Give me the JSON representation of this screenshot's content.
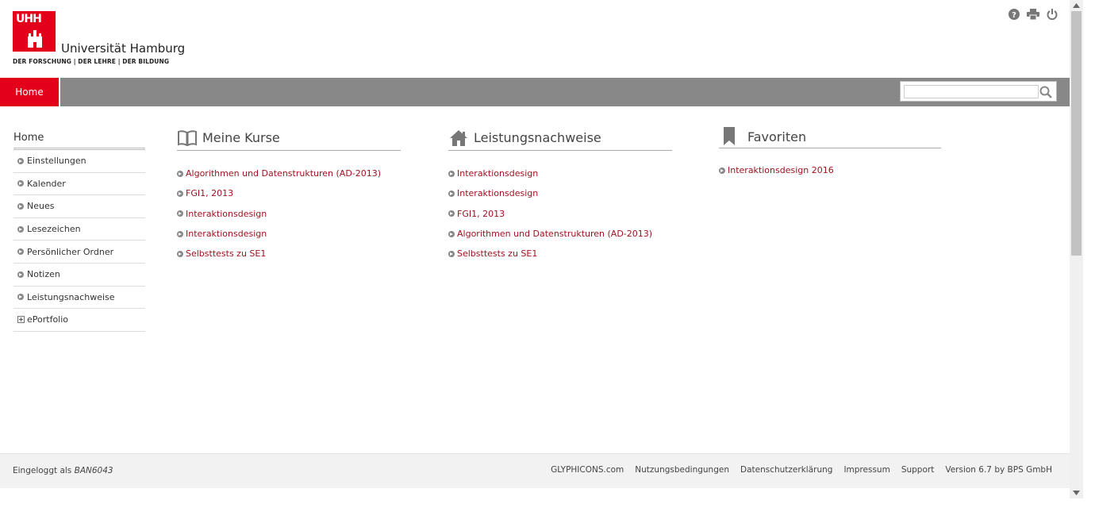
{
  "header": {
    "logo_mark": "UHH",
    "logo_name": "Universität Hamburg",
    "logo_tagline": "DER FORSCHUNG | DER LEHRE | DER BILDUNG",
    "tools": [
      "help-icon",
      "print-icon",
      "power-icon"
    ]
  },
  "nav": {
    "home_label": "Home",
    "search_placeholder": ""
  },
  "sidebar": {
    "title": "Home",
    "items": [
      {
        "label": "Einstellungen"
      },
      {
        "label": "Kalender"
      },
      {
        "label": "Neues"
      },
      {
        "label": "Lesezeichen"
      },
      {
        "label": "Persönlicher Ordner"
      },
      {
        "label": "Notizen"
      },
      {
        "label": "Leistungsnachweise"
      },
      {
        "label": "ePortfolio"
      }
    ]
  },
  "columns": {
    "kurse": {
      "title": "Meine Kurse",
      "icon": "book-icon",
      "links": [
        "Algorithmen und Datenstrukturen (AD-2013)",
        "FGI1, 2013",
        "Interaktionsdesign",
        "Interaktionsdesign",
        "Selbsttests zu SE1"
      ]
    },
    "leistung": {
      "title": "Leistungsnachweise",
      "icon": "home-icon",
      "links": [
        "Interaktionsdesign",
        "Interaktionsdesign",
        "FGI1, 2013",
        "Algorithmen und Datenstrukturen (AD-2013)",
        "Selbsttests zu SE1"
      ]
    },
    "favoriten": {
      "title": "Favoriten",
      "icon": "bookmark-icon",
      "links": [
        "Interaktionsdesign 2016"
      ]
    }
  },
  "footer": {
    "logged_in_prefix": "Eingeloggt als",
    "user": "BAN6043",
    "links": [
      "GLYPHICONS.com",
      "Nutzungsbedingungen",
      "Datenschutzerklärung",
      "Impressum",
      "Support",
      "Version 6.7 by BPS GmbH"
    ]
  },
  "colors": {
    "brand_red": "#e2001a",
    "link_red": "#9e0f1d",
    "nav_gray": "#888888"
  }
}
